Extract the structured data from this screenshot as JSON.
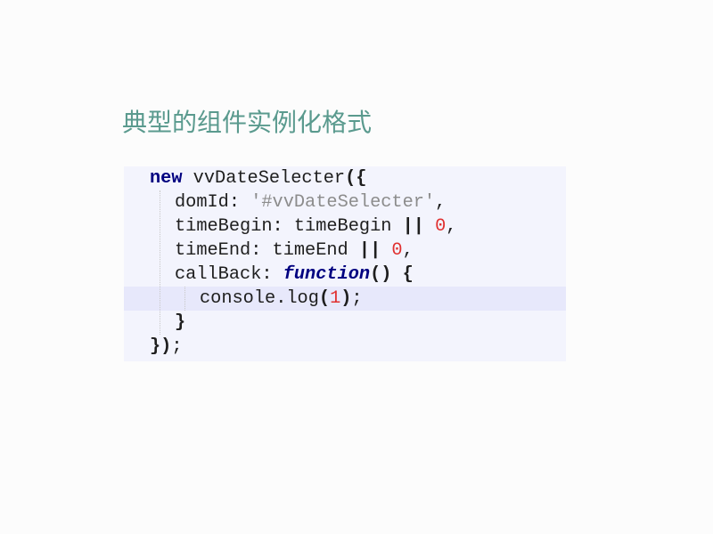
{
  "slide": {
    "title": "典型的组件实例化格式"
  },
  "code": {
    "lines": [
      {
        "indent": 1,
        "highlighted": false,
        "tokens": [
          {
            "type": "keyword",
            "text": "new"
          },
          {
            "type": "plain",
            "text": " vvDateSelecter"
          },
          {
            "type": "punct",
            "text": "({"
          }
        ]
      },
      {
        "indent": 3,
        "highlighted": false,
        "tokens": [
          {
            "type": "plain",
            "text": "domId: "
          },
          {
            "type": "string",
            "text": "'#vvDateSelecter'"
          },
          {
            "type": "plain",
            "text": ","
          }
        ]
      },
      {
        "indent": 3,
        "highlighted": false,
        "tokens": [
          {
            "type": "plain",
            "text": "timeBegin: timeBegin "
          },
          {
            "type": "operator",
            "text": "||"
          },
          {
            "type": "plain",
            "text": " "
          },
          {
            "type": "number",
            "text": "0"
          },
          {
            "type": "plain",
            "text": ","
          }
        ]
      },
      {
        "indent": 3,
        "highlighted": false,
        "tokens": [
          {
            "type": "plain",
            "text": "timeEnd: timeEnd "
          },
          {
            "type": "operator",
            "text": "||"
          },
          {
            "type": "plain",
            "text": " "
          },
          {
            "type": "number",
            "text": "0"
          },
          {
            "type": "plain",
            "text": ","
          }
        ]
      },
      {
        "indent": 3,
        "highlighted": false,
        "tokens": [
          {
            "type": "plain",
            "text": "callBack: "
          },
          {
            "type": "keyword-italic",
            "text": "function"
          },
          {
            "type": "punct",
            "text": "()"
          },
          {
            "type": "plain",
            "text": " "
          },
          {
            "type": "punct",
            "text": "{"
          }
        ]
      },
      {
        "indent": 5,
        "highlighted": true,
        "tokens": [
          {
            "type": "plain",
            "text": "console.log"
          },
          {
            "type": "punct",
            "text": "("
          },
          {
            "type": "number",
            "text": "1"
          },
          {
            "type": "punct",
            "text": ")"
          },
          {
            "type": "plain",
            "text": ";"
          }
        ]
      },
      {
        "indent": 3,
        "highlighted": false,
        "tokens": [
          {
            "type": "punct",
            "text": "}"
          }
        ]
      },
      {
        "indent": 1,
        "highlighted": false,
        "tokens": [
          {
            "type": "punct",
            "text": "})"
          },
          {
            "type": "plain",
            "text": ";"
          }
        ]
      }
    ]
  },
  "colors": {
    "page_background": "#fcfcfc",
    "title": "#5a9a8e",
    "code_background": "#f3f4fd",
    "current_line_background": "#e7e8fb",
    "indent_guide": "#c8c8c8",
    "plain": "#1e1e1e",
    "keyword": "#000080",
    "string": "#8c8c8c",
    "number": "#e03030",
    "punct": "#1e1e1e",
    "operator": "#1e1e1e"
  }
}
